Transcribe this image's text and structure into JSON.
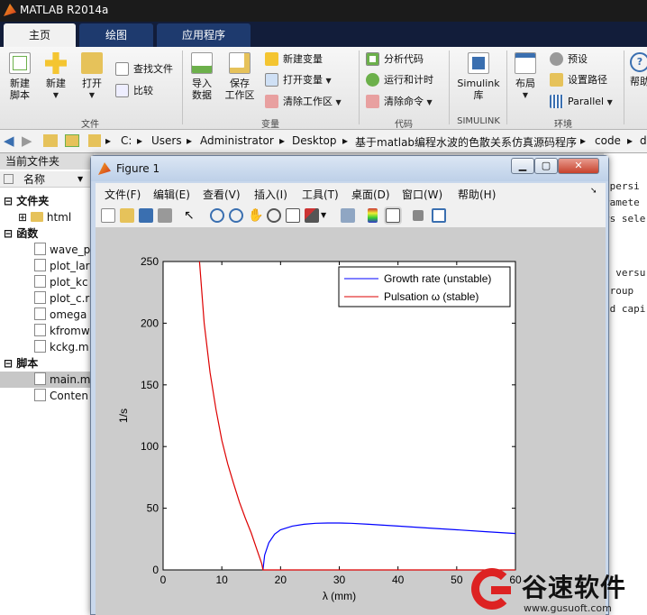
{
  "window": {
    "title": "MATLAB R2014a"
  },
  "tabs": [
    {
      "label": "主页"
    },
    {
      "label": "绘图"
    },
    {
      "label": "应用程序"
    }
  ],
  "ribbon": {
    "file": {
      "new_script": "新建\n脚本",
      "new": "新建",
      "open": "打开",
      "find_files": "查找文件",
      "compare": "比较",
      "group": "文件"
    },
    "variable": {
      "import": "导入\n数据",
      "save_ws": "保存\n工作区",
      "new_var": "新建变量",
      "open_var": "打开变量",
      "clear_ws": "清除工作区",
      "group": "变量"
    },
    "code": {
      "analyze": "分析代码",
      "run_time": "运行和计时",
      "clear_cmd": "清除命令",
      "group": "代码"
    },
    "simulink": {
      "lib": "Simulink\n库",
      "group": "SIMULINK"
    },
    "env": {
      "layout": "布局",
      "prefs": "预设",
      "set_path": "设置路径",
      "parallel": "Parallel",
      "group": "环境"
    },
    "help": {
      "label": "帮助"
    }
  },
  "address": {
    "segments": [
      "C:",
      "Users",
      "Administrator",
      "Desktop",
      "基于matlab编程水波的色散关系仿真源码程序",
      "code",
      "d"
    ]
  },
  "left_panel": {
    "title": "当前文件夹",
    "column": "名称",
    "sections": {
      "folders": "文件夹",
      "functions": "函数",
      "scripts": "脚本"
    },
    "folders": [
      {
        "name": "html"
      }
    ],
    "functions": [
      {
        "name": "wave_p"
      },
      {
        "name": "plot_lar"
      },
      {
        "name": "plot_kc"
      },
      {
        "name": "plot_c.r"
      },
      {
        "name": "omega"
      },
      {
        "name": "kfromw"
      },
      {
        "name": "kckg.m"
      }
    ],
    "scripts": [
      {
        "name": "main.m"
      },
      {
        "name": "Conten"
      }
    ]
  },
  "command_window": {
    "lines": [
      "spersi",
      "ramete",
      "rs sele",
      "",
      "",
      "n versu",
      "group",
      "nd capi"
    ]
  },
  "figure": {
    "title": "Figure 1",
    "menu": [
      "文件(F)",
      "编辑(E)",
      "查看(V)",
      "插入(I)",
      "工具(T)",
      "桌面(D)",
      "窗口(W)",
      "帮助(H)"
    ],
    "toolbar_icons": [
      "new-figure-icon",
      "open-icon",
      "save-icon",
      "print-icon",
      "pointer-icon",
      "zoom-in-icon",
      "zoom-out-icon",
      "pan-icon",
      "rotate-icon",
      "data-cursor-icon",
      "brush-icon",
      "link-icon",
      "colorbar-icon",
      "legend-icon",
      "hide-plot-tools-icon",
      "show-plot-tools-icon"
    ]
  },
  "chart_data": {
    "type": "line",
    "title": "",
    "xlabel": "λ (mm)",
    "ylabel": "1/s",
    "xlim": [
      0,
      60
    ],
    "ylim": [
      0,
      250
    ],
    "xticks": [
      0,
      10,
      20,
      30,
      40,
      50,
      60
    ],
    "yticks": [
      0,
      50,
      100,
      150,
      200,
      250
    ],
    "legend_position": "top-right",
    "series": [
      {
        "name": "Growth rate (unstable)",
        "color": "#0000ff",
        "x": [
          17.0,
          17.3,
          18,
          19,
          20,
          22,
          24,
          26,
          28,
          30,
          32,
          35,
          40,
          45,
          50,
          55,
          60
        ],
        "y": [
          0,
          12,
          22,
          29,
          32.5,
          35.5,
          37,
          37.8,
          38,
          38,
          37.8,
          37,
          35.5,
          34,
          32.5,
          31,
          29.5
        ]
      },
      {
        "name": "Pulsation ω (stable)",
        "color": "#dd0000",
        "x": [
          6.2,
          7,
          8,
          9,
          10,
          11,
          12,
          13,
          14,
          15,
          16,
          16.8,
          17,
          18,
          20,
          30,
          40,
          50,
          60
        ],
        "y": [
          250,
          200,
          160,
          130,
          105,
          86,
          70,
          55,
          42,
          30,
          16,
          5,
          0,
          0,
          0,
          0,
          0,
          0,
          0
        ]
      }
    ]
  },
  "watermark": {
    "text": "谷速软件",
    "url": "www.gusuoft.com"
  },
  "colors": {
    "title_bar": "#1b1b1b",
    "tab_bar": "#121d3a",
    "plot_bg": "#ffffff",
    "figure_bg": "#cccccc"
  }
}
